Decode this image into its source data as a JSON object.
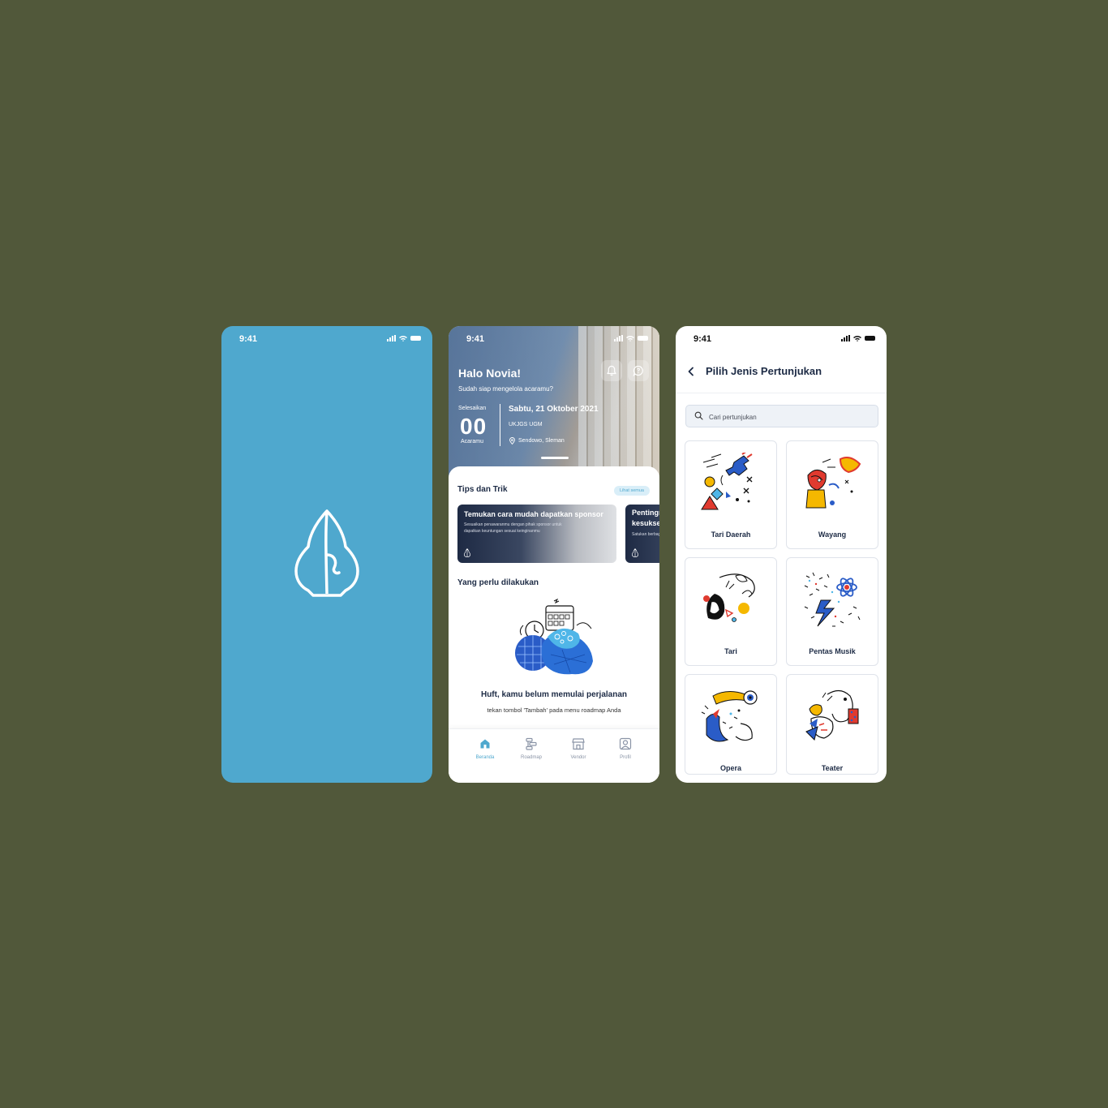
{
  "splash": {
    "time": "9:41",
    "logo_icon": "gunungan-icon",
    "background": "#4fa8ce"
  },
  "home": {
    "time": "9:41",
    "greeting": "Halo Novia!",
    "subtitle": "Sudah siap mengelola acaramu?",
    "counter": {
      "label_top": "Selesaikan",
      "value": "00",
      "label_bottom": "Acaramu"
    },
    "event": {
      "date": "Sabtu, 21 Oktober 2021",
      "place": "UKJGS UGM",
      "location": "Sendowo, Sleman"
    },
    "tips_title": "Tips dan Trik",
    "see_all": "Lihat semua",
    "tips": [
      {
        "title": "Temukan cara mudah dapatkan sponsor",
        "desc": "Sesuaikan penawaranmu dengan pihak sponsor untuk dapatkan keuntungan sesuai keinginanmu"
      },
      {
        "title": "Pentingnya kesuksesan",
        "desc": "Satukan berbagai"
      }
    ],
    "todo_title": "Yang perlu dilakukan",
    "empty_title": "Huft, kamu belum memulai perjalanan",
    "empty_desc": "tekan tombol 'Tambah' pada menu roadmap Anda",
    "tabs": [
      {
        "label": "Beranda",
        "icon": "home-icon",
        "active": true
      },
      {
        "label": "Roadmap",
        "icon": "roadmap-icon",
        "active": false
      },
      {
        "label": "Vendor",
        "icon": "store-icon",
        "active": false
      },
      {
        "label": "Profil",
        "icon": "profile-icon",
        "active": false
      }
    ],
    "accent": "#4fa8ce"
  },
  "picker": {
    "time": "9:41",
    "title": "Pilih Jenis Pertunjukan",
    "search_placeholder": "Cari pertunjukan",
    "categories": [
      {
        "label": "Tari Daerah"
      },
      {
        "label": "Wayang"
      },
      {
        "label": "Tari"
      },
      {
        "label": "Pentas Musik"
      },
      {
        "label": "Opera"
      },
      {
        "label": "Teater"
      }
    ]
  },
  "background": "#51583a"
}
